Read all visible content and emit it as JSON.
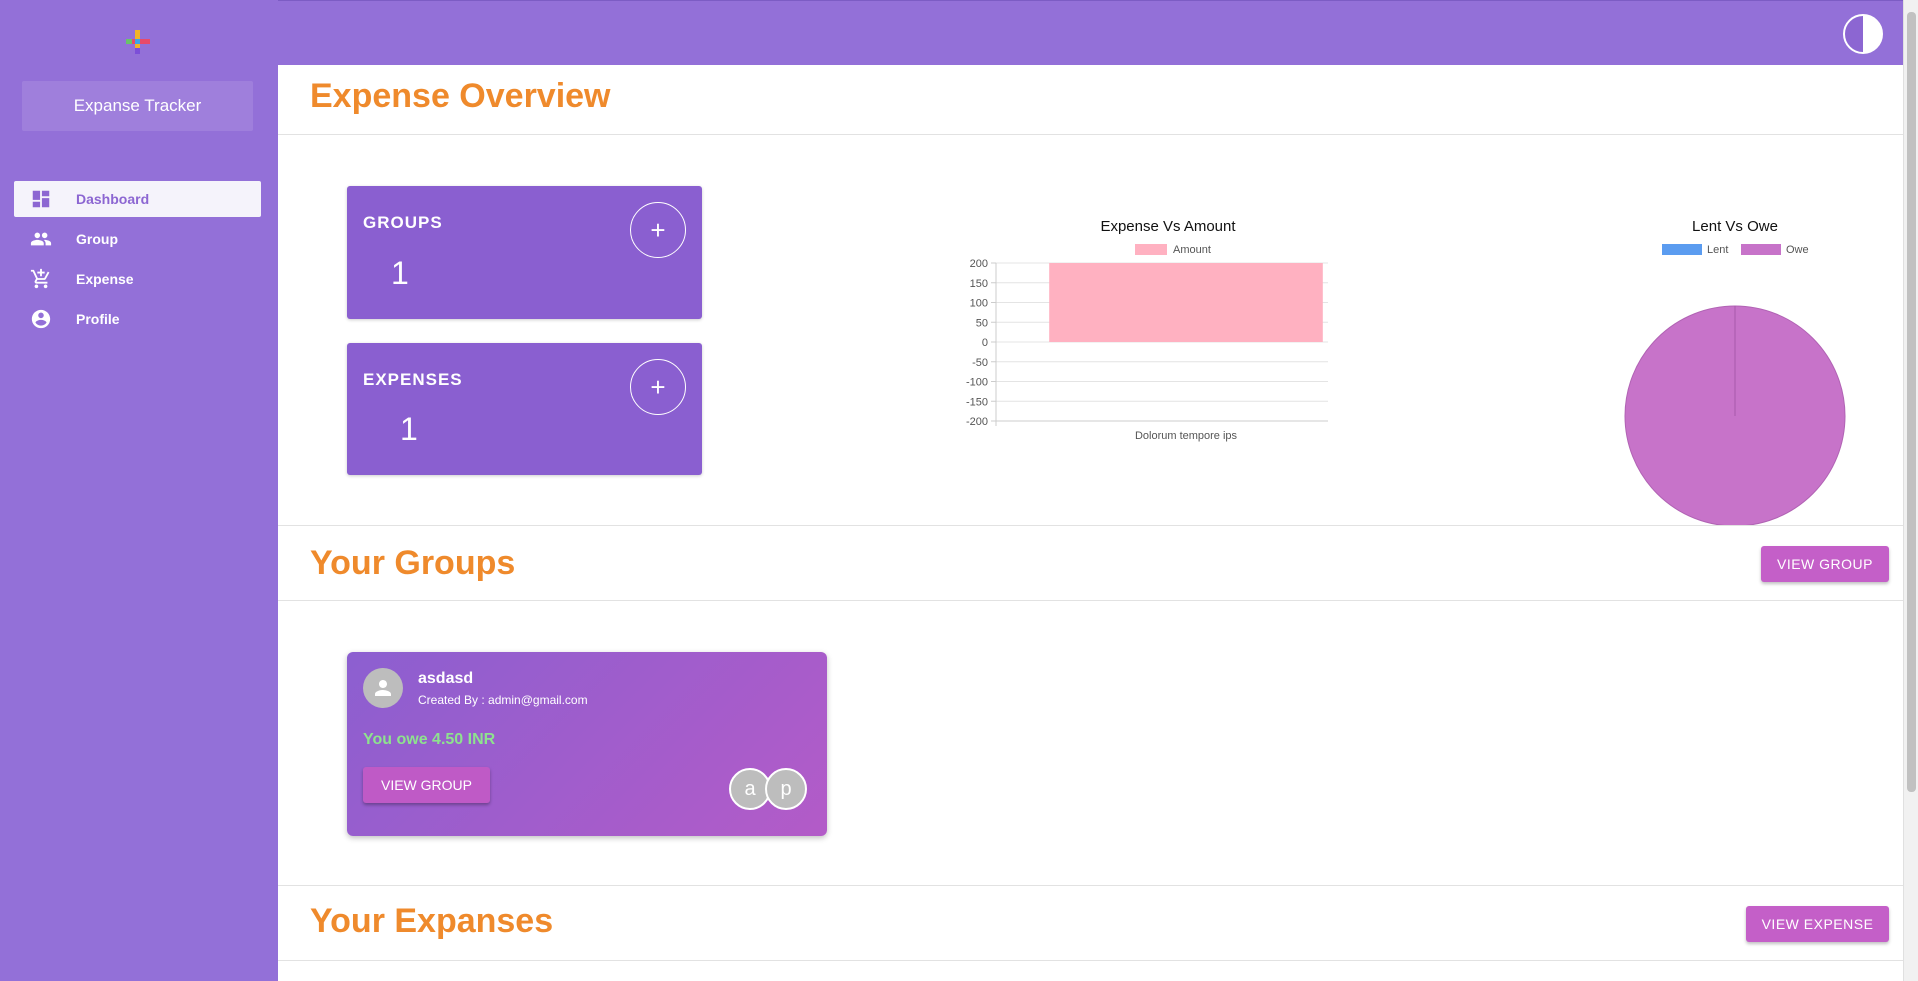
{
  "sidebar": {
    "app_title": "Expanse Tracker",
    "items": [
      {
        "label": "Dashboard",
        "icon": "dashboard-icon",
        "active": true
      },
      {
        "label": "Group",
        "icon": "people-icon",
        "active": false
      },
      {
        "label": "Expense",
        "icon": "add-cart-icon",
        "active": false
      },
      {
        "label": "Profile",
        "icon": "account-circle-icon",
        "active": false
      }
    ]
  },
  "overview": {
    "title": "Expense Overview",
    "groups": {
      "label": "GROUPS",
      "value": "1",
      "add_label": "+"
    },
    "expenses": {
      "label": "EXPENSES",
      "value": "1",
      "add_label": "+"
    }
  },
  "groups_section": {
    "title": "Your Groups",
    "button": "VIEW GROUP"
  },
  "group_card": {
    "name": "asdasd",
    "creator": "Created By : admin@gmail.com",
    "owe": "You owe 4.50 INR",
    "button": "VIEW GROUP",
    "members": [
      "a",
      "p"
    ]
  },
  "expenses_section": {
    "title": "Your Expanses",
    "button": "VIEW EXPENSE"
  },
  "colors": {
    "sidebar": "#9370d8",
    "accent_orange": "#ef8a2c",
    "card_purple": "#8a5fd0",
    "button_pink": "#c45fc8",
    "owe_green": "#8ee28e"
  },
  "chart_data": [
    {
      "type": "bar",
      "title": "Expense Vs Amount",
      "categories": [
        "Dolorum tempore ips"
      ],
      "series": [
        {
          "name": "Amount",
          "values": [
            200
          ],
          "color": "#ffb1c1"
        }
      ],
      "ylim": [
        -200,
        200
      ],
      "yticks": [
        200,
        150,
        100,
        50,
        0,
        -50,
        -100,
        -150,
        -200
      ],
      "legend": "top"
    },
    {
      "type": "pie",
      "title": "Lent Vs Owe",
      "labels": [
        "Lent",
        "Owe"
      ],
      "values": [
        0,
        4.5
      ],
      "colors": [
        "#5b9cf0",
        "#c773c9"
      ],
      "legend": "top"
    }
  ]
}
